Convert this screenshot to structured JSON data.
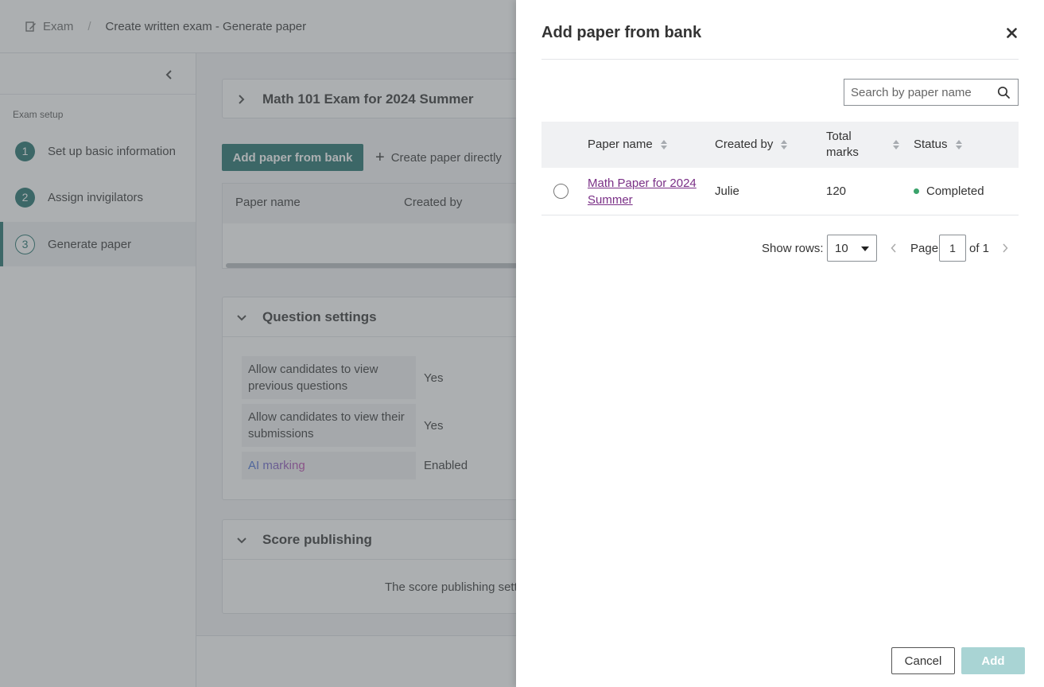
{
  "breadcrumb": {
    "home_icon": "exam-edit-icon",
    "home": "Exam",
    "separator": "/",
    "current": "Create written exam - Generate paper"
  },
  "sidebar": {
    "collapse_icon": "chevron-left-icon",
    "section_label": "Exam setup",
    "steps": [
      {
        "num": "1",
        "label": "Set up basic information"
      },
      {
        "num": "2",
        "label": "Assign invigilators"
      },
      {
        "num": "3",
        "label": "Generate paper"
      }
    ]
  },
  "main": {
    "exam_title": "Math 101 Exam for 2024 Summer",
    "add_from_bank": "Add paper from bank",
    "create_directly": "Create paper directly",
    "table_headers": [
      "Paper name",
      "Created by"
    ],
    "question_settings": {
      "title": "Question settings",
      "rows": [
        {
          "key": "Allow candidates to view previous questions",
          "value": "Yes"
        },
        {
          "key": "Allow candidates to view their submissions",
          "value": "Yes"
        },
        {
          "key": "AI marking",
          "value": "Enabled"
        }
      ]
    },
    "score_publishing": {
      "title": "Score publishing",
      "text": "The score publishing setti"
    }
  },
  "drawer": {
    "title": "Add paper from bank",
    "close_icon": "close-icon",
    "search": {
      "placeholder": "Search by paper name",
      "icon": "search-icon"
    },
    "columns": [
      "Paper name",
      "Created by",
      "Total marks",
      "Status"
    ],
    "rows": [
      {
        "paper_name": "Math Paper for 2024 Summer",
        "created_by": "Julie",
        "total_marks": "120",
        "status": "Completed",
        "status_color": "#3aa36b"
      }
    ],
    "pagination": {
      "show_rows_label": "Show rows:",
      "rows_value": "10",
      "page_label": "Page",
      "page_value": "1",
      "of_label": "of 1"
    },
    "cancel": "Cancel",
    "add": "Add"
  },
  "colors": {
    "brand": "#1e6f6a",
    "add_disabled": "#a9d4d4",
    "link": "#7a2f86",
    "status_completed": "#3aa36b"
  }
}
